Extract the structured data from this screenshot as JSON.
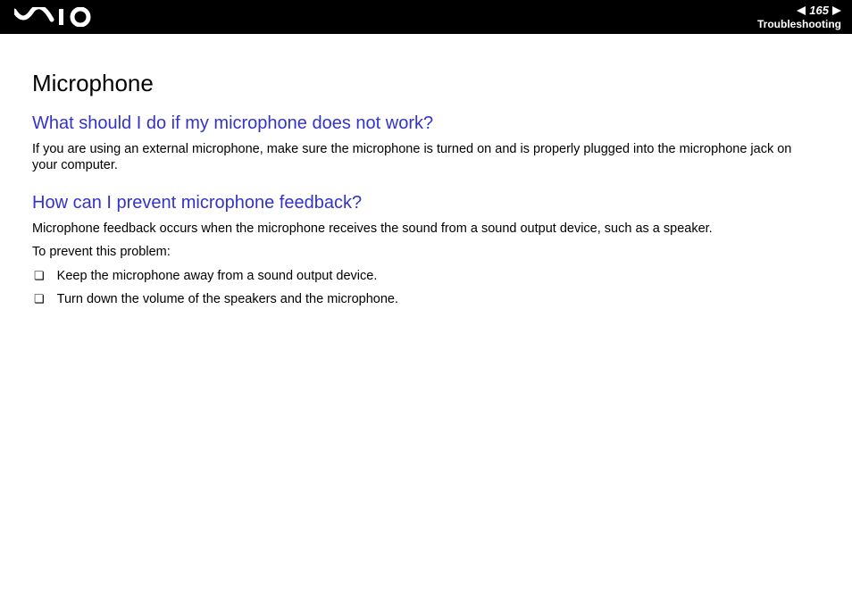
{
  "header": {
    "page_number": "165",
    "section": "Troubleshooting"
  },
  "content": {
    "title": "Microphone",
    "q1": {
      "question": "What should I do if my microphone does not work?",
      "answer": "If you are using an external microphone, make sure the microphone is turned on and is properly plugged into the microphone jack on your computer."
    },
    "q2": {
      "question": "How can I prevent microphone feedback?",
      "intro": "Microphone feedback occurs when the microphone receives the sound from a sound output device, such as a speaker.",
      "prevent_label": "To prevent this problem:",
      "items": [
        "Keep the microphone away from a sound output device.",
        "Turn down the volume of the speakers and the microphone."
      ]
    }
  }
}
